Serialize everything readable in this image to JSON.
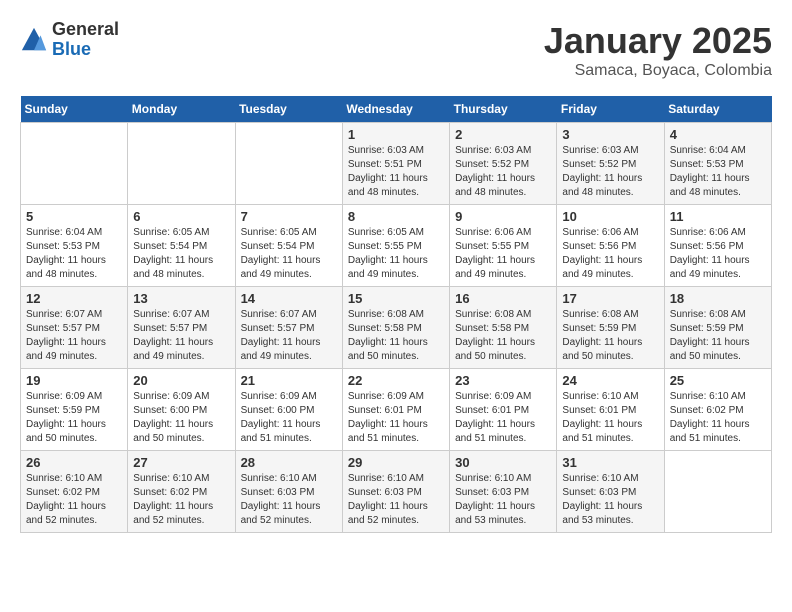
{
  "header": {
    "logo_general": "General",
    "logo_blue": "Blue",
    "month": "January 2025",
    "location": "Samaca, Boyaca, Colombia"
  },
  "weekdays": [
    "Sunday",
    "Monday",
    "Tuesday",
    "Wednesday",
    "Thursday",
    "Friday",
    "Saturday"
  ],
  "weeks": [
    [
      {
        "day": "",
        "info": ""
      },
      {
        "day": "",
        "info": ""
      },
      {
        "day": "",
        "info": ""
      },
      {
        "day": "1",
        "info": "Sunrise: 6:03 AM\nSunset: 5:51 PM\nDaylight: 11 hours\nand 48 minutes."
      },
      {
        "day": "2",
        "info": "Sunrise: 6:03 AM\nSunset: 5:52 PM\nDaylight: 11 hours\nand 48 minutes."
      },
      {
        "day": "3",
        "info": "Sunrise: 6:03 AM\nSunset: 5:52 PM\nDaylight: 11 hours\nand 48 minutes."
      },
      {
        "day": "4",
        "info": "Sunrise: 6:04 AM\nSunset: 5:53 PM\nDaylight: 11 hours\nand 48 minutes."
      }
    ],
    [
      {
        "day": "5",
        "info": "Sunrise: 6:04 AM\nSunset: 5:53 PM\nDaylight: 11 hours\nand 48 minutes."
      },
      {
        "day": "6",
        "info": "Sunrise: 6:05 AM\nSunset: 5:54 PM\nDaylight: 11 hours\nand 48 minutes."
      },
      {
        "day": "7",
        "info": "Sunrise: 6:05 AM\nSunset: 5:54 PM\nDaylight: 11 hours\nand 49 minutes."
      },
      {
        "day": "8",
        "info": "Sunrise: 6:05 AM\nSunset: 5:55 PM\nDaylight: 11 hours\nand 49 minutes."
      },
      {
        "day": "9",
        "info": "Sunrise: 6:06 AM\nSunset: 5:55 PM\nDaylight: 11 hours\nand 49 minutes."
      },
      {
        "day": "10",
        "info": "Sunrise: 6:06 AM\nSunset: 5:56 PM\nDaylight: 11 hours\nand 49 minutes."
      },
      {
        "day": "11",
        "info": "Sunrise: 6:06 AM\nSunset: 5:56 PM\nDaylight: 11 hours\nand 49 minutes."
      }
    ],
    [
      {
        "day": "12",
        "info": "Sunrise: 6:07 AM\nSunset: 5:57 PM\nDaylight: 11 hours\nand 49 minutes."
      },
      {
        "day": "13",
        "info": "Sunrise: 6:07 AM\nSunset: 5:57 PM\nDaylight: 11 hours\nand 49 minutes."
      },
      {
        "day": "14",
        "info": "Sunrise: 6:07 AM\nSunset: 5:57 PM\nDaylight: 11 hours\nand 49 minutes."
      },
      {
        "day": "15",
        "info": "Sunrise: 6:08 AM\nSunset: 5:58 PM\nDaylight: 11 hours\nand 50 minutes."
      },
      {
        "day": "16",
        "info": "Sunrise: 6:08 AM\nSunset: 5:58 PM\nDaylight: 11 hours\nand 50 minutes."
      },
      {
        "day": "17",
        "info": "Sunrise: 6:08 AM\nSunset: 5:59 PM\nDaylight: 11 hours\nand 50 minutes."
      },
      {
        "day": "18",
        "info": "Sunrise: 6:08 AM\nSunset: 5:59 PM\nDaylight: 11 hours\nand 50 minutes."
      }
    ],
    [
      {
        "day": "19",
        "info": "Sunrise: 6:09 AM\nSunset: 5:59 PM\nDaylight: 11 hours\nand 50 minutes."
      },
      {
        "day": "20",
        "info": "Sunrise: 6:09 AM\nSunset: 6:00 PM\nDaylight: 11 hours\nand 50 minutes."
      },
      {
        "day": "21",
        "info": "Sunrise: 6:09 AM\nSunset: 6:00 PM\nDaylight: 11 hours\nand 51 minutes."
      },
      {
        "day": "22",
        "info": "Sunrise: 6:09 AM\nSunset: 6:01 PM\nDaylight: 11 hours\nand 51 minutes."
      },
      {
        "day": "23",
        "info": "Sunrise: 6:09 AM\nSunset: 6:01 PM\nDaylight: 11 hours\nand 51 minutes."
      },
      {
        "day": "24",
        "info": "Sunrise: 6:10 AM\nSunset: 6:01 PM\nDaylight: 11 hours\nand 51 minutes."
      },
      {
        "day": "25",
        "info": "Sunrise: 6:10 AM\nSunset: 6:02 PM\nDaylight: 11 hours\nand 51 minutes."
      }
    ],
    [
      {
        "day": "26",
        "info": "Sunrise: 6:10 AM\nSunset: 6:02 PM\nDaylight: 11 hours\nand 52 minutes."
      },
      {
        "day": "27",
        "info": "Sunrise: 6:10 AM\nSunset: 6:02 PM\nDaylight: 11 hours\nand 52 minutes."
      },
      {
        "day": "28",
        "info": "Sunrise: 6:10 AM\nSunset: 6:03 PM\nDaylight: 11 hours\nand 52 minutes."
      },
      {
        "day": "29",
        "info": "Sunrise: 6:10 AM\nSunset: 6:03 PM\nDaylight: 11 hours\nand 52 minutes."
      },
      {
        "day": "30",
        "info": "Sunrise: 6:10 AM\nSunset: 6:03 PM\nDaylight: 11 hours\nand 53 minutes."
      },
      {
        "day": "31",
        "info": "Sunrise: 6:10 AM\nSunset: 6:03 PM\nDaylight: 11 hours\nand 53 minutes."
      },
      {
        "day": "",
        "info": ""
      }
    ]
  ]
}
